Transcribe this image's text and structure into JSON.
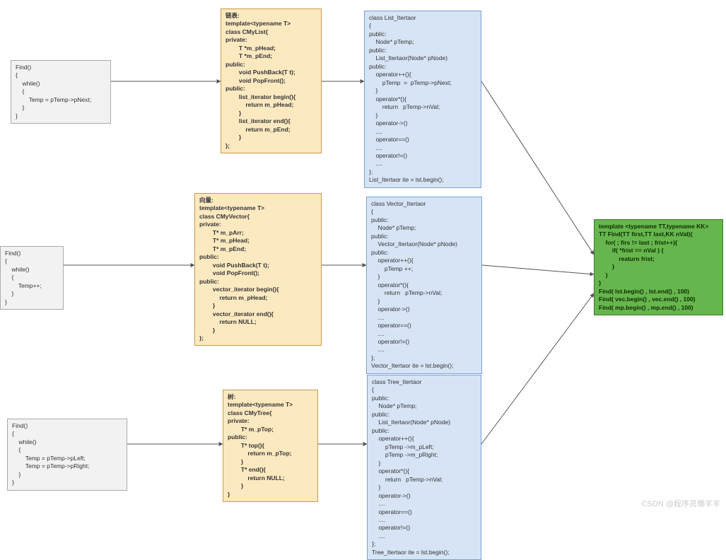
{
  "watermark": "CSDN @程序员懒羊羊",
  "gray1": "Find()\n{\n    while()\n    {\n        Temp = pTemp->pNext;\n    }\n}",
  "gray2": "Find()\n{\n    while()\n    {\n        Temp++;\n    }\n}",
  "gray3": "Find()\n{\n    while()\n    {\n        Temp = pTemp->pLeft;\n        Temp = pTemp->pRight;\n    }\n}",
  "yellow1": "链表:\ntemplate<typename T>\nclass CMyList{\nprivate:\n        T *m_pHead;\n        T *m_pEnd;\npublic:\n        void PushBack(T t);\n        void PopFront();\npublic:\n        list_iterator begin(){\n            return m_pHead;\n        }\n        list_iterator end(){\n            return m_pEnd;\n        }\n};",
  "yellow2": "向量:\ntemplate<typename T>\nclass CMyVector{\nprivate:\n        T* m_pArr;\n        T* m_pHead;\n        T* m_pEnd;\npublic:\n        void PushBack(T t);\n        void PopFront();\npublic:\n        vector_iterator begin(){\n            return m_pHead;\n        }\n        vector_iterator end(){\n            return NULL;\n        }\n};",
  "yellow3": "树:\ntemplate<typename T>\nclass CMyTree{\nprivate:\n        T* m_pTop;\npublic:\n        T* top(){\n            return m_pTop;\n        }\n        T* end(){\n            return NULL;\n        }\n}",
  "blue1": "class List_Itertaor\n{\npublic:\n    Node* pTemp;\npublic:\n    List_Itertaor(Node* pNode)\npublic:\n    operator++(){\n        pTemp  =  pTemp->pNext;\n    }\n    operator*(){\n        return   pTemp->nVal;\n    }\n    operator->()\n    ....\n    operator==()\n    ....\n    operator!=()\n    ....\n};\nList_Itertaor ite = lst.begin();",
  "blue2": "class Vector_Itertaor\n{\npublic:\n    Node* pTemp;\npublic:\n    Vector_Itertaor(Node* pNode)\npublic:\n    operator++(){\n        pTemp ++;\n    }\n    operator*(){\n        return   pTemp->nVal;\n    }\n    operator->()\n    ....\n    operator==()\n    ....\n    operator!=()\n    ....\n};\nVector_Itertaor ite = lst.begin();",
  "blue3": "class Tree_Itertaor\n{\npublic:\n    Node* pTemp;\npublic:\n    List_Itertaor(Node* pNode)\npublic:\n    operator++(){\n        pTemp ->m_pLeft;\n        pTemp ->m_pRight;\n    }\n    operator*(){\n        return   pTemp->nVal;\n    }\n    operator->()\n    ....\n    operator==()\n    ....\n    operator!=()\n    ....\n};\nTree_Itertaor ite = lst.begin();",
  "green": "template <typename TT,typename KK>\nTT Find(TT first,TT last,KK nVal){\n    for( ; firs != last ; frist++){\n        if( *frist == nVal ) {\n            reaturn frist;\n        }\n    }\n}\nFind( lst.begin() , lst.end() , 100)\nFind( vec.begin() , vec.end() , 100)\nFind( mp.begin() , mp.end() , 100)"
}
